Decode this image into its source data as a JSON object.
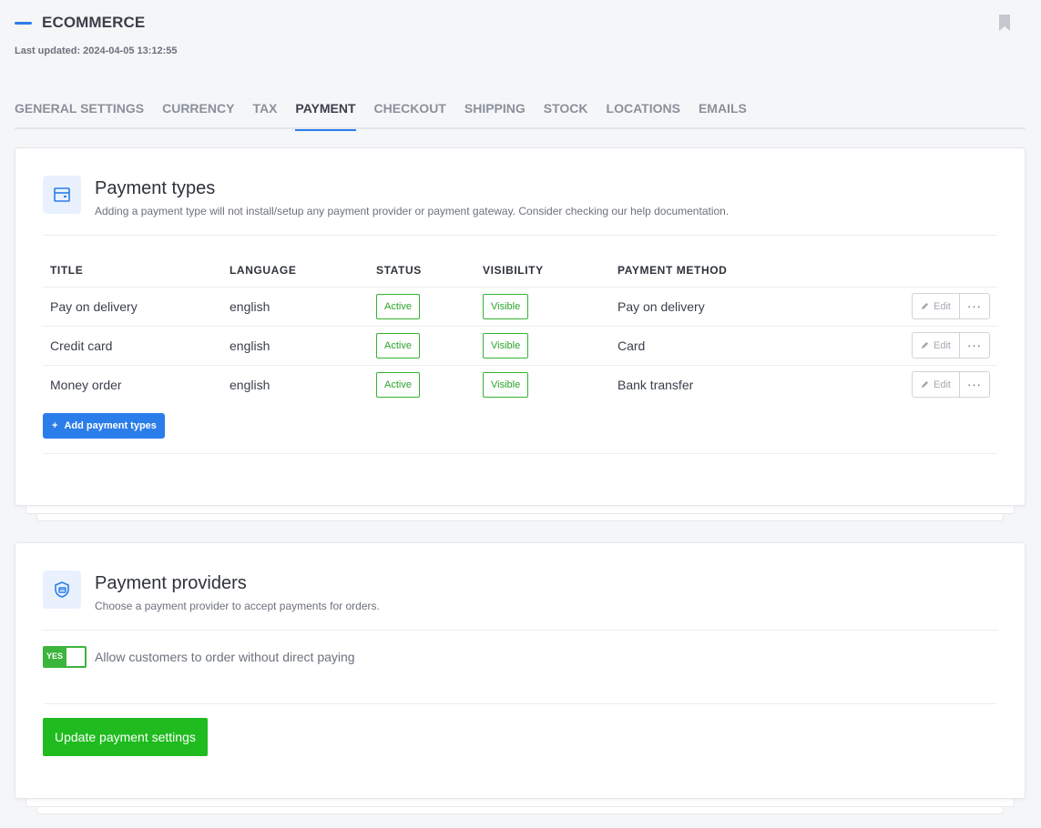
{
  "header": {
    "title": "ECOMMERCE",
    "updated": "Last updated: 2024-04-05 13:12:55"
  },
  "tabs": [
    {
      "label": "GENERAL SETTINGS",
      "active": false
    },
    {
      "label": "CURRENCY",
      "active": false
    },
    {
      "label": "TAX",
      "active": false
    },
    {
      "label": "PAYMENT",
      "active": true
    },
    {
      "label": "CHECKOUT",
      "active": false
    },
    {
      "label": "SHIPPING",
      "active": false
    },
    {
      "label": "STOCK",
      "active": false
    },
    {
      "label": "LOCATIONS",
      "active": false
    },
    {
      "label": "EMAILS",
      "active": false
    }
  ],
  "payment_types": {
    "title": "Payment types",
    "description": "Adding a payment type will not install/setup any payment provider or payment gateway. Consider checking our help documentation.",
    "columns": [
      "TITLE",
      "LANGUAGE",
      "STATUS",
      "VISIBILITY",
      "PAYMENT METHOD"
    ],
    "rows": [
      {
        "title": "Pay on delivery",
        "language": "english",
        "status": "Active",
        "visibility": "Visible",
        "method": "Pay on delivery",
        "edit": "Edit"
      },
      {
        "title": "Credit card",
        "language": "english",
        "status": "Active",
        "visibility": "Visible",
        "method": "Card",
        "edit": "Edit"
      },
      {
        "title": "Money order",
        "language": "english",
        "status": "Active",
        "visibility": "Visible",
        "method": "Bank transfer",
        "edit": "Edit"
      }
    ],
    "add_label": "Add payment types"
  },
  "payment_providers": {
    "title": "Payment providers",
    "description": "Choose a payment provider to accept payments for orders.",
    "toggle_text": "YES",
    "toggle_label": "Allow customers to order without direct paying",
    "update_label": "Update payment settings"
  },
  "colors": {
    "accent": "#2b7de9",
    "success": "#1fbb1f"
  }
}
